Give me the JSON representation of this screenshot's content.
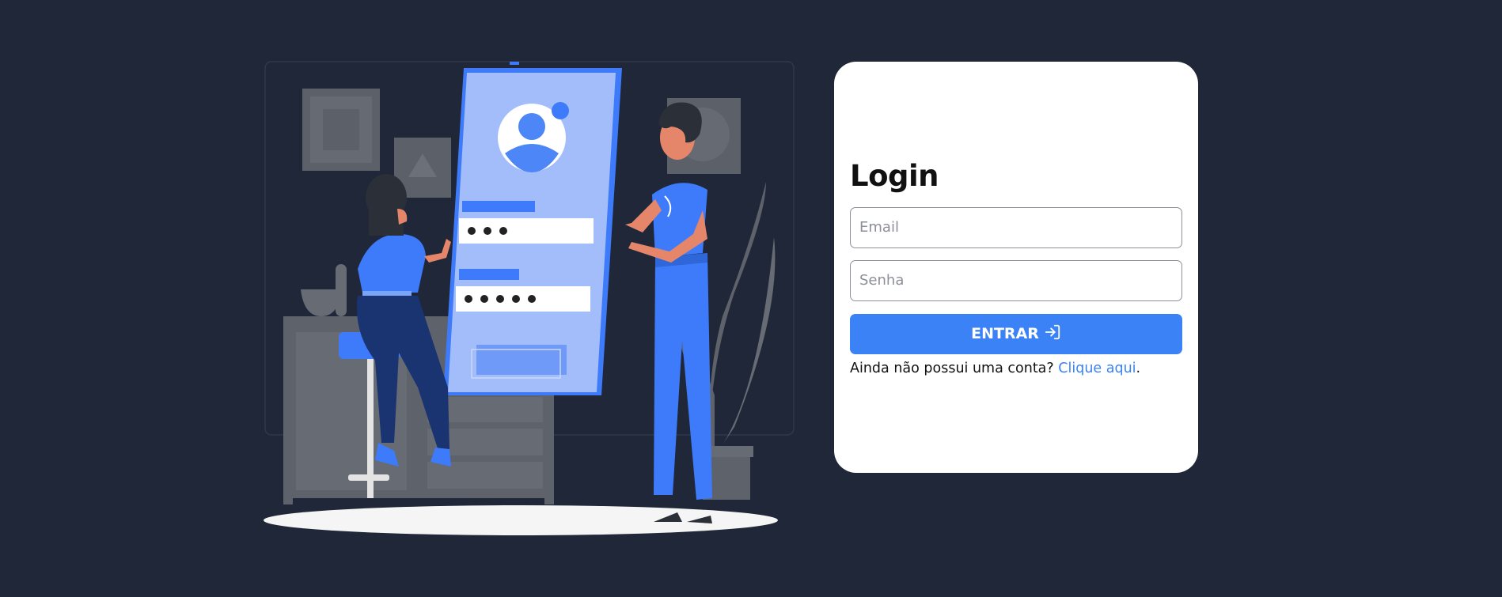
{
  "login": {
    "title": "Login",
    "email_placeholder": "Email",
    "password_placeholder": "Senha",
    "submit_label": "ENTRAR",
    "submit_icon": "sign-in-icon",
    "signup_prompt": "Ainda não possui uma conta?",
    "signup_link": "Clique aqui",
    "signup_suffix": "."
  },
  "colors": {
    "background": "#1f2738",
    "card": "#ffffff",
    "accent": "#3b82f6"
  }
}
